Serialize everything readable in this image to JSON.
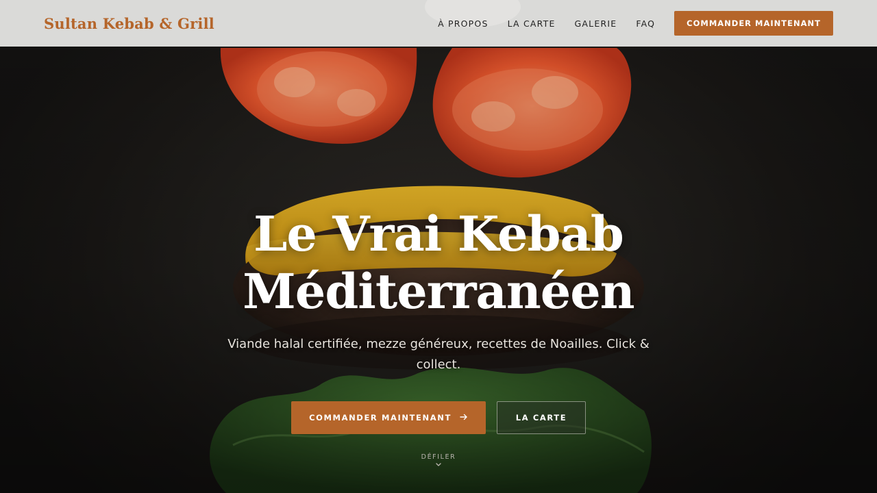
{
  "header": {
    "brand": "Sultan Kebab & Grill",
    "nav": {
      "about": "À PROPOS",
      "menu": "LA CARTE",
      "gallery": "GALERIE",
      "faq": "FAQ"
    },
    "cta": "COMMANDER MAINTENANT"
  },
  "hero": {
    "title_line1": "Le Vrai Kebab",
    "title_line2": "Méditerranéen",
    "subtitle": "Viande halal certifiée, mezze généreux, recettes de Noailles. Click & collect.",
    "primary_button": "COMMANDER MAINTENANT",
    "primary_icon": "arrow-right-icon",
    "secondary_button": "LA CARTE",
    "scroll_label": "DÉFILER",
    "scroll_icon": "chevron-down-icon"
  },
  "colors": {
    "accent": "#b5652a",
    "header_bg": "#e9e9e7",
    "hero_bg": "#1d1a17"
  }
}
